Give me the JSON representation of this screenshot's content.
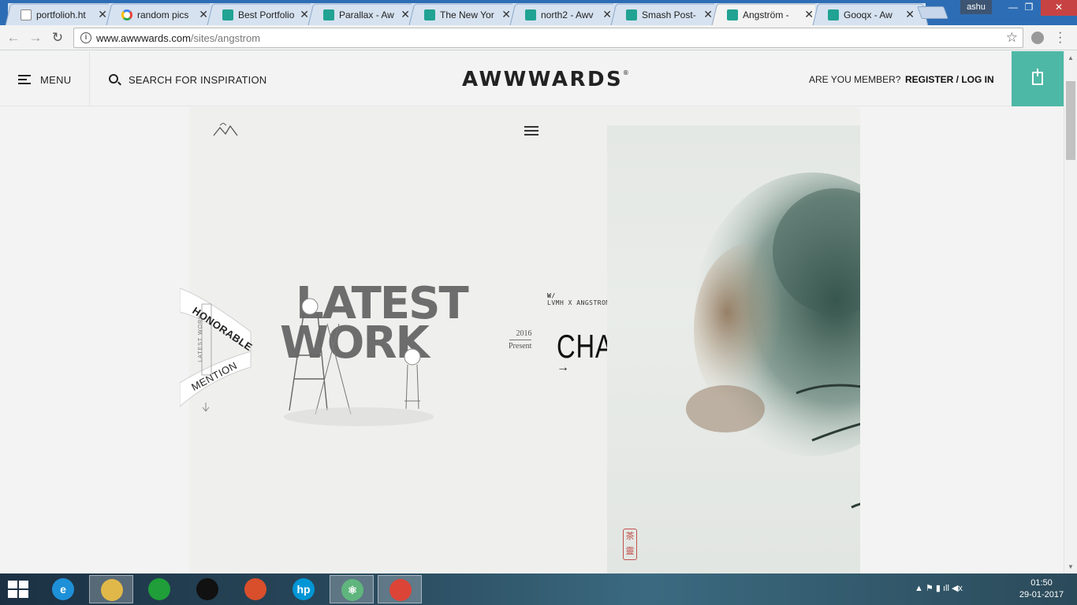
{
  "browser": {
    "tabs": [
      {
        "title": "portfolioh.ht",
        "favicon": "doc-icon",
        "active": false
      },
      {
        "title": "random pics",
        "favicon": "google-icon",
        "active": false
      },
      {
        "title": "Best Portfolio",
        "favicon": "awwwards-icon",
        "active": false
      },
      {
        "title": "Parallax - Aw",
        "favicon": "awwwards-icon",
        "active": false
      },
      {
        "title": "The New Yor",
        "favicon": "awwwards-icon",
        "active": false
      },
      {
        "title": "north2 - Awv",
        "favicon": "awwwards-icon",
        "active": false
      },
      {
        "title": "Smash Post-",
        "favicon": "awwwards-icon",
        "active": false
      },
      {
        "title": "Angström - ",
        "favicon": "awwwards-icon",
        "active": true
      },
      {
        "title": "Gooqx - Aw",
        "favicon": "awwwards-icon",
        "active": false
      }
    ],
    "user": "ashu",
    "url_host": "www.awwwards.com",
    "url_path": "/sites/angstrom"
  },
  "site": {
    "menu_label": "MENU",
    "search_label": "SEARCH FOR INSPIRATION",
    "logo": "AWWWARDS",
    "logo_mark": "®",
    "member_question": "ARE YOU MEMBER?",
    "register_label": "REGISTER / LOG IN",
    "accent_color": "#4eb8a6"
  },
  "preview": {
    "ribbon_top": "HONORABLE",
    "ribbon_bottom": "MENTION",
    "ribbon_side": "LATEST WORK",
    "latest_art_line1": "LATEST",
    "latest_art_line2": "WORK",
    "tag_line1": "W/",
    "tag_line2": "LVMH X ANGSTROM",
    "year_start": "2016",
    "year_end": "Present",
    "project_title": "CHA LING",
    "seal_text_1": "茶",
    "seal_text_2": "靈"
  },
  "taskbar": {
    "apps": [
      {
        "name": "internet-explorer-icon",
        "glyph": "e",
        "color": "#1e90d8",
        "active": false
      },
      {
        "name": "file-explorer-icon",
        "glyph": "",
        "color": "#e0b84a",
        "active": true
      },
      {
        "name": "store-icon",
        "glyph": "",
        "color": "#1f9e3a",
        "active": false
      },
      {
        "name": "webcam-icon",
        "glyph": "",
        "color": "#111111",
        "active": false
      },
      {
        "name": "paint-icon",
        "glyph": "",
        "color": "#d94f2b",
        "active": false
      },
      {
        "name": "hp-icon",
        "glyph": "hp",
        "color": "#0096d6",
        "active": false
      },
      {
        "name": "atom-icon",
        "glyph": "⚛",
        "color": "#5fb57d",
        "active": true
      },
      {
        "name": "chrome-icon",
        "glyph": "",
        "color": "#db4437",
        "active": true
      }
    ],
    "time": "01:50",
    "date": "29-01-2017"
  }
}
